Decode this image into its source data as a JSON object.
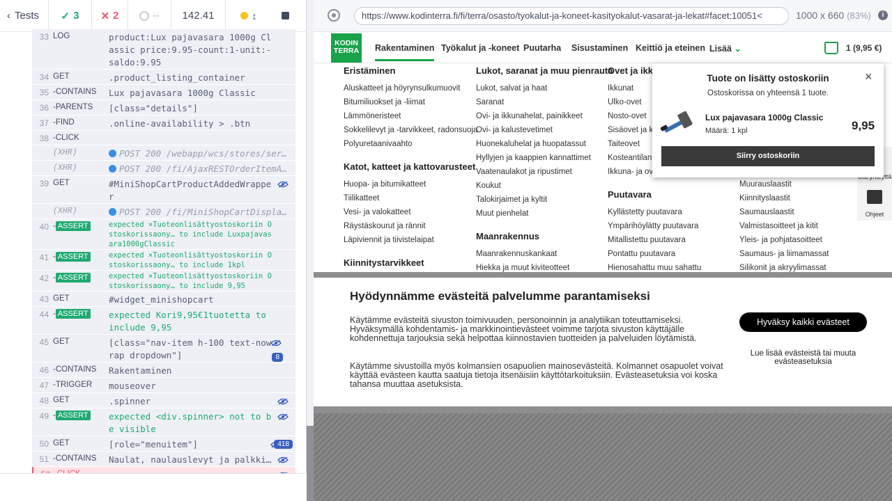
{
  "reporter": {
    "tests_label": "Tests",
    "passed": "3",
    "failed": "2",
    "pending": "--",
    "duration": "142.41"
  },
  "commands": [
    {
      "num": "33",
      "name": "LOG",
      "msg": "product:Lux pajavasara 1000g Classic price:9.95-count:1-unit:-saldo:9.95",
      "type": "normal"
    },
    {
      "num": "34",
      "name": "GET",
      "msg": ".product_listing_container",
      "type": "normal"
    },
    {
      "num": "35",
      "name": "-CONTAINS",
      "msg": "Lux pajavasara 1000g Classic",
      "type": "normal"
    },
    {
      "num": "36",
      "name": "-PARENTS",
      "msg": "[class=\"details\"]",
      "type": "normal"
    },
    {
      "num": "37",
      "name": "-FIND",
      "msg": ".online-availability > .btn",
      "type": "normal"
    },
    {
      "num": "38",
      "name": "-CLICK",
      "msg": "",
      "type": "normal"
    },
    {
      "num": "",
      "name": "(XHR)",
      "msg": "POST 200 /webapp/wcs/stores/servl…",
      "type": "xhr"
    },
    {
      "num": "",
      "name": "(XHR)",
      "msg": "POST 200 /fi/AjaxRESTOrderItemAdd",
      "type": "xhr"
    },
    {
      "num": "39",
      "name": "GET",
      "msg": "#MiniShopCartProductAddedWrapper",
      "type": "normal"
    },
    {
      "num": "",
      "name": "(XHR)",
      "msg": "POST 200 /fi/MiniShopCartDisplayV…",
      "type": "xhr"
    },
    {
      "num": "40",
      "name": "-ASSERT",
      "msg": "expected ×Tuoteonlisättyostoskoriin Ostoskorissaony… to include Luxpajavasara1000gClassic",
      "type": "assert-small"
    },
    {
      "num": "41",
      "name": "-ASSERT",
      "msg": "expected ×Tuoteonlisättyostoskoriin Ostoskorissaony… to include 1kpl",
      "type": "assert-small"
    },
    {
      "num": "42",
      "name": "-ASSERT",
      "msg": "expected ×Tuoteonlisättyostoskoriin Ostoskorissaony… to include 9,95",
      "type": "assert-small"
    },
    {
      "num": "43",
      "name": "GET",
      "msg": "#widget_minishopcart",
      "type": "normal"
    },
    {
      "num": "44",
      "name": "-ASSERT",
      "msg": "expected Kori9,95€1tuotetta to include 9,95",
      "type": "assert"
    },
    {
      "num": "45",
      "name": "GET",
      "msg": "[class=\"nav-item h-100 text-nowrap dropdown\"]",
      "type": "normal",
      "count": "8"
    },
    {
      "num": "46",
      "name": "-CONTAINS",
      "msg": "Rakentaminen",
      "type": "normal"
    },
    {
      "num": "47",
      "name": "-TRIGGER",
      "msg": "mouseover",
      "type": "normal"
    },
    {
      "num": "48",
      "name": "GET",
      "msg": ".spinner",
      "type": "normal"
    },
    {
      "num": "49",
      "name": "-ASSERT",
      "msg": "expected <div.spinner> not to be visible",
      "type": "assert"
    },
    {
      "num": "50",
      "name": "GET",
      "msg": "[role=\"menuitem\"]",
      "type": "normal",
      "count": "418"
    },
    {
      "num": "51",
      "name": "-CONTAINS",
      "msg": "Naulat, naulauslevyt ja palkkik…",
      "type": "normal"
    },
    {
      "num": "52",
      "name": "-CLICK",
      "msg": "",
      "type": "fail"
    }
  ],
  "browser": {
    "url": "https://www.kodinterra.fi/fi/terra/osasto/tyokalut-ja-koneet-kasityokalut-vasarat-ja-lekat#facet:10051<",
    "viewport": "1000 x 660",
    "zoom": "(83%)"
  },
  "site": {
    "logo_line1": "KODIN",
    "logo_line2": "TERRA",
    "nav": [
      "Rakentaminen",
      "Työkalut ja -koneet",
      "Puutarha",
      "Sisustaminen",
      "Keittiö ja eteinen",
      "Lisää"
    ],
    "cart": "1 (9,95 €)",
    "menu_col1": {
      "head1": "Eristäminen",
      "items1": [
        "Aluskatteet ja höyrynsulkumuovit",
        "Bitumiliuokset ja -liimat",
        "Lämmöneristeet",
        "Sokkelilevyt ja -tarvikkeet, radonsuoja",
        "Polyuretaanivaahto"
      ],
      "head2": "Katot, katteet ja kattovarusteet",
      "items2": [
        "Huopa- ja bitumikatteet",
        "Tiilikatteet",
        "Vesi- ja valokatteet",
        "Räystäskourut ja rännit",
        "Läpiviennit ja tiivistelaipat"
      ],
      "head3": "Kiinnitystarvikkeet"
    },
    "menu_col2": {
      "head1": "Lukot, saranat ja muu pienrauta",
      "items1": [
        "Lukot, salvat ja haat",
        "Saranat",
        "Ovi- ja ikkunahelat, painikkeet",
        "Ovi- ja kalustevetimet",
        "Huonekaluhelat ja huopatassut",
        "Hyllyjen ja kaappien kannattimet",
        "Vaatenaulakot ja ripustimet",
        "Koukut",
        "Talokirjaimet ja kyltit",
        "Muut pienhelat"
      ],
      "head2": "Maanrakennus",
      "items2": [
        "Maanrakennuskankaat",
        "Hiekka ja muut kiviteotteet"
      ]
    },
    "menu_col3": {
      "head1": "Ovet ja ikku",
      "items1": [
        "Ikkunat",
        "Ulko-ovet",
        "Nosto-ovet",
        "Sisäovet ja ka",
        "Taiteovet",
        "Kosteantilan ja",
        "Ikkuna- ja ovit"
      ],
      "head2": "Puutavara",
      "items2": [
        "Kyllästetty puutavara",
        "Ympärihöylätty puutavara",
        "Mitallistettu puutavara",
        "Pontattu puutavara",
        "Hienosahattu muu sahattu"
      ]
    },
    "menu_col4": {
      "items": [
        "Muurauslaastit",
        "Kiinnityslaastit",
        "Saumauslaastit",
        "Valmistasoitteet ja kitit",
        "Yleis- ja pohjatasoitteet",
        "Saumaus- ja liimamassat",
        "Silikonit ja akryylimassat"
      ]
    },
    "side_label1": "Ota yhteyttä",
    "side_label2": "Ohjeet"
  },
  "popup": {
    "title": "Tuote on lisätty ostoskoriin",
    "subtitle": "Ostoskorissa on yhteensä 1 tuote.",
    "close": "×",
    "product_name": "Lux pajavasara 1000g Classic",
    "qty": "Määrä: 1 kpl",
    "price": "9,95",
    "checkout": "Siirry ostoskoriin"
  },
  "cookie": {
    "title": "Hyödynnämme evästeitä palvelumme parantamiseksi",
    "p1": "Käytämme evästeitä sivuston toimivuuden, personoinnin ja analytiikan toteuttamiseksi. Hyväksymällä kohdentamis- ja markkinointievästeet voimme tarjota sivuston käyttäjälle kohdennettuja tarjouksia sekä helpottaa kiinnostavien tuotteiden ja palveluiden löytämistä.",
    "p2": "Käytämme sivustoilla myös kolmansien osapuolien mainosevästeitä. Kolmannet osapuolet voivat käyttää evästeen kautta saatuja tietoja itsenäisiin käyttötarkoituksiin. Evästeasetuksia voi koska tahansa muuttaa asetuksista.",
    "accept": "Hyväksy kaikki evästeet",
    "more": "Lue lisää evästeistä tai muuta evästeasetuksia"
  }
}
